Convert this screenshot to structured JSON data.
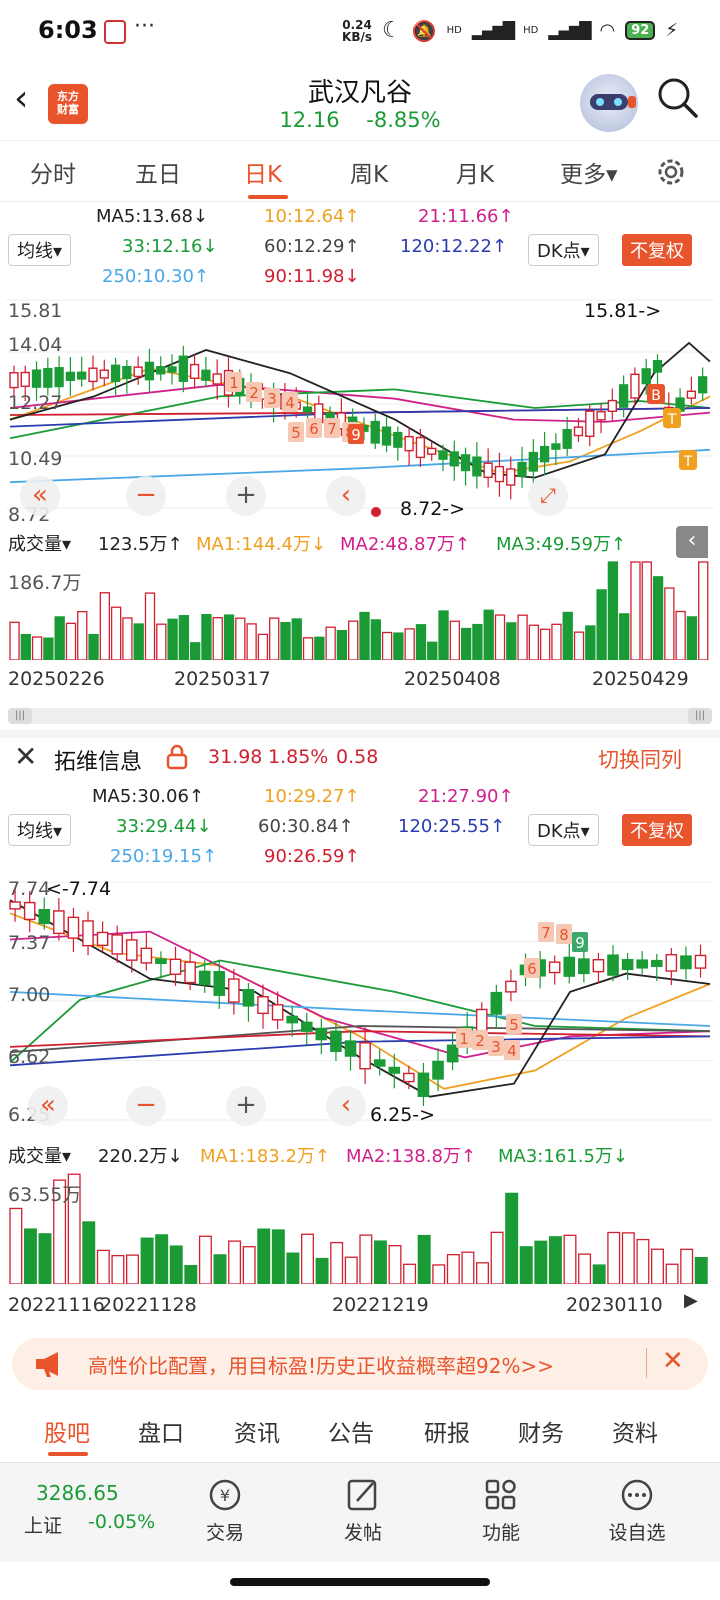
{
  "status": {
    "time": "6:03",
    "net_speed_1": "0.24",
    "net_speed_2": "KB/s",
    "hd1": "HD",
    "hd2": "HD",
    "battery": "92"
  },
  "header": {
    "stock_name": "武汉凡谷",
    "price": "12.16",
    "change": "-8.85%",
    "logo_line1": "东方",
    "logo_line2": "财富"
  },
  "tabs": [
    {
      "label": "分时"
    },
    {
      "label": "五日"
    },
    {
      "label": "日K"
    },
    {
      "label": "周K"
    },
    {
      "label": "月K"
    },
    {
      "label": "更多▾"
    }
  ],
  "chart1": {
    "ma": {
      "ma5": "MA5:13.68↓",
      "ma10": "10:12.64↑",
      "ma21": "21:11.66↑",
      "ma33": "33:12.16↓",
      "ma60": "60:12.29↑",
      "ma120": "120:12.22↑",
      "ma250": "250:10.30↑",
      "ma90": "90:11.98↓"
    },
    "indicator_select": "均线▾",
    "dk_select": "DK点▾",
    "fuquan": "不复权",
    "y_ticks": [
      "15.81",
      "14.04",
      "12.27",
      "10.49",
      "8.72"
    ],
    "high_label": "15.81->",
    "low_label": "8.72->",
    "volume": {
      "select": "成交量▾",
      "value": "123.5万↑",
      "ma1": "MA1:144.4万↓",
      "ma2": "MA2:48.87万↑",
      "ma3": "MA3:49.59万↑",
      "max": "186.7万"
    },
    "dates": [
      "20250226",
      "20250317",
      "20250408",
      "20250429"
    ],
    "markers": [
      "1",
      "2",
      "3",
      "4",
      "5",
      "6",
      "7",
      "8",
      "9",
      "B",
      "T",
      "T"
    ]
  },
  "chart2": {
    "head": {
      "name": "拓维信息",
      "price": "31.98",
      "pct": "1.85%",
      "chg": "0.58",
      "switch": "切换同列"
    },
    "ma": {
      "ma5": "MA5:30.06↑",
      "ma10": "10:29.27↑",
      "ma21": "21:27.90↑",
      "ma33": "33:29.44↓",
      "ma60": "60:30.84↑",
      "ma120": "120:25.55↑",
      "ma250": "250:19.15↑",
      "ma90": "90:26.59↑"
    },
    "indicator_select": "均线▾",
    "dk_select": "DK点▾",
    "fuquan": "不复权",
    "y_ticks": [
      "7.74",
      "7.37",
      "7.00",
      "6.62",
      "6.25"
    ],
    "high_label": "<-7.74",
    "low_label": "6.25->",
    "volume": {
      "select": "成交量▾",
      "value": "220.2万↓",
      "ma1": "MA1:183.2万↑",
      "ma2": "MA2:138.8万↑",
      "ma3": "MA3:161.5万↓",
      "max": "63.55万"
    },
    "dates": [
      "20221116",
      "20221128",
      "20221219",
      "20230110"
    ],
    "markers": [
      "1",
      "2",
      "3",
      "4",
      "5",
      "6",
      "7",
      "8",
      "9"
    ]
  },
  "banner": {
    "text": "高性价比配置，用目标盈!历史正收益概率超92%>>"
  },
  "bottom_tabs": [
    {
      "label": "股吧"
    },
    {
      "label": "盘口"
    },
    {
      "label": "资讯"
    },
    {
      "label": "公告"
    },
    {
      "label": "研报"
    },
    {
      "label": "财务"
    },
    {
      "label": "资料"
    }
  ],
  "index": {
    "value": "3286.65",
    "name": "上证",
    "change": "-0.05%"
  },
  "bottom_bar": [
    {
      "label": "交易"
    },
    {
      "label": "发帖"
    },
    {
      "label": "功能"
    },
    {
      "label": "设自选"
    }
  ],
  "colors": {
    "up": "#d02030",
    "down": "#1a9b36",
    "accent": "#e8542c"
  }
}
